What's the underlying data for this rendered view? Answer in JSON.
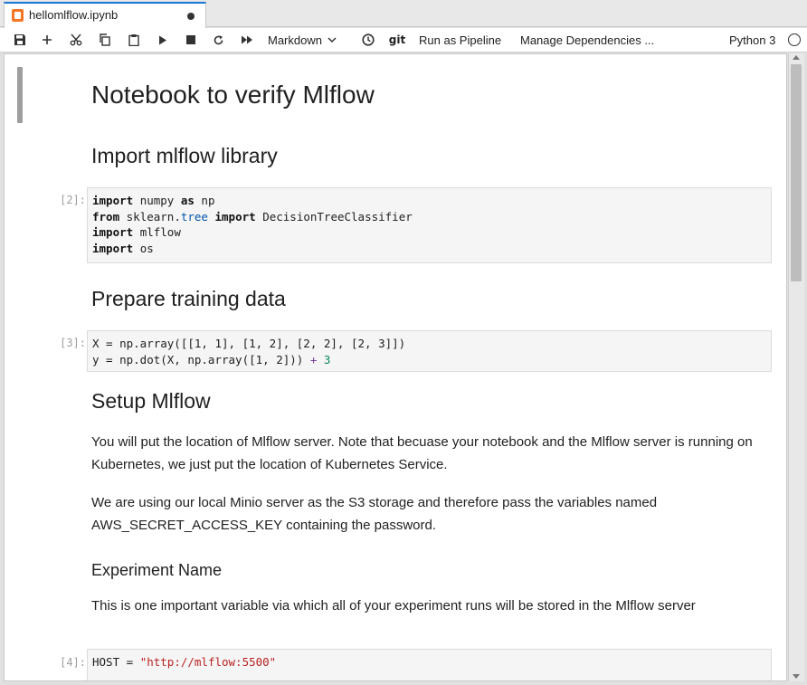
{
  "tab": {
    "title": "hellomlflow.ipynb",
    "icon": "notebook-icon",
    "dirty_icon": "unsaved-dot-icon"
  },
  "toolbar": {
    "icons": [
      "save-icon",
      "add-cell-icon",
      "cut-icon",
      "copy-icon",
      "paste-icon",
      "run-icon",
      "stop-icon",
      "restart-icon",
      "fast-forward-icon",
      "history-icon"
    ],
    "cell_type": "Markdown",
    "git_label": "git",
    "run_pipeline": "Run as Pipeline",
    "manage_deps": "Manage Dependencies ...",
    "kernel": "Python 3"
  },
  "notebook": {
    "title": "Notebook to verify Mlflow",
    "section_import": "Import mlflow library",
    "cell2": {
      "prompt": "[2]:",
      "lines": [
        [
          [
            "kw",
            "import"
          ],
          [
            "",
            "numpy "
          ],
          [
            "kw",
            "as"
          ],
          [
            "",
            "np"
          ]
        ],
        [
          [
            "kw",
            "from"
          ],
          [
            "",
            "sklearn."
          ],
          [
            "mod",
            "tree"
          ],
          [
            "",
            ""
          ],
          [
            "kw",
            "import"
          ],
          [
            "",
            "DecisionTreeClassifier"
          ]
        ],
        [
          [
            "kw",
            "import"
          ],
          [
            "",
            "mlflow"
          ]
        ],
        [
          [
            "kw",
            "import"
          ],
          [
            "",
            "os"
          ]
        ]
      ]
    },
    "section_prepare": "Prepare training data",
    "cell3": {
      "prompt": "[3]:",
      "lines": [
        [
          [
            "",
            "X = np.array([[1, 1], [1, 2], [2, 2], [2, 3]])"
          ]
        ],
        [
          [
            "",
            "y = np.dot(X, np.array([1, 2])) "
          ],
          [
            "op",
            "+"
          ],
          [
            "",
            ""
          ],
          [
            "num",
            "3"
          ]
        ]
      ]
    },
    "section_setup": "Setup Mlflow",
    "para1": "You will put the location of Mlflow server. Note that becuase your notebook and the Mlflow server is running on Kubernetes, we just put the location of Kubernetes Service.",
    "para2": "We are using our local Minio server as the S3 storage and therefore pass the variables named AWS_SECRET_ACCESS_KEY containing the password.",
    "section_experiment": "Experiment Name",
    "para3": "This is one important variable via which all of your experiment runs will be stored in the Mlflow server",
    "cell4": {
      "prompt": "[4]:",
      "lines": [
        [
          [
            "",
            "HOST = "
          ],
          [
            "str",
            "\"http://mlflow:5500\""
          ]
        ]
      ]
    }
  },
  "scrollbar": {
    "position_fraction": 0.02
  }
}
